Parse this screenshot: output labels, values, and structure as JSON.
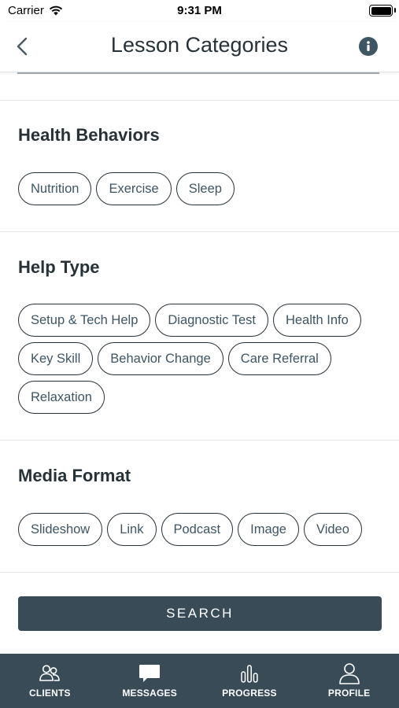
{
  "status_bar": {
    "carrier": "Carrier",
    "time": "9:31 PM"
  },
  "header": {
    "title": "Lesson Categories",
    "back_icon": "chevron-left-icon",
    "info_icon": "info-icon"
  },
  "sections": [
    {
      "title": "Health Behaviors",
      "chips": [
        "Nutrition",
        "Exercise",
        "Sleep"
      ]
    },
    {
      "title": "Help Type",
      "chips": [
        "Setup & Tech Help",
        "Diagnostic Test",
        "Health Info",
        "Key Skill",
        "Behavior Change",
        "Care Referral",
        "Relaxation"
      ]
    },
    {
      "title": "Media Format",
      "chips": [
        "Slideshow",
        "Link",
        "Podcast",
        "Image",
        "Video"
      ]
    }
  ],
  "search_button": {
    "label": "SEARCH"
  },
  "tab_bar": {
    "tabs": [
      {
        "label": "CLIENTS",
        "icon": "clients-icon"
      },
      {
        "label": "MESSAGES",
        "icon": "messages-icon"
      },
      {
        "label": "PROGRESS",
        "icon": "progress-icon"
      },
      {
        "label": "PROFILE",
        "icon": "profile-icon"
      }
    ]
  },
  "colors": {
    "primary": "#3a4b58",
    "text": "#263238",
    "chip_text": "#3e5563",
    "background": "#ffffff",
    "divider": "#e4e7ea"
  }
}
